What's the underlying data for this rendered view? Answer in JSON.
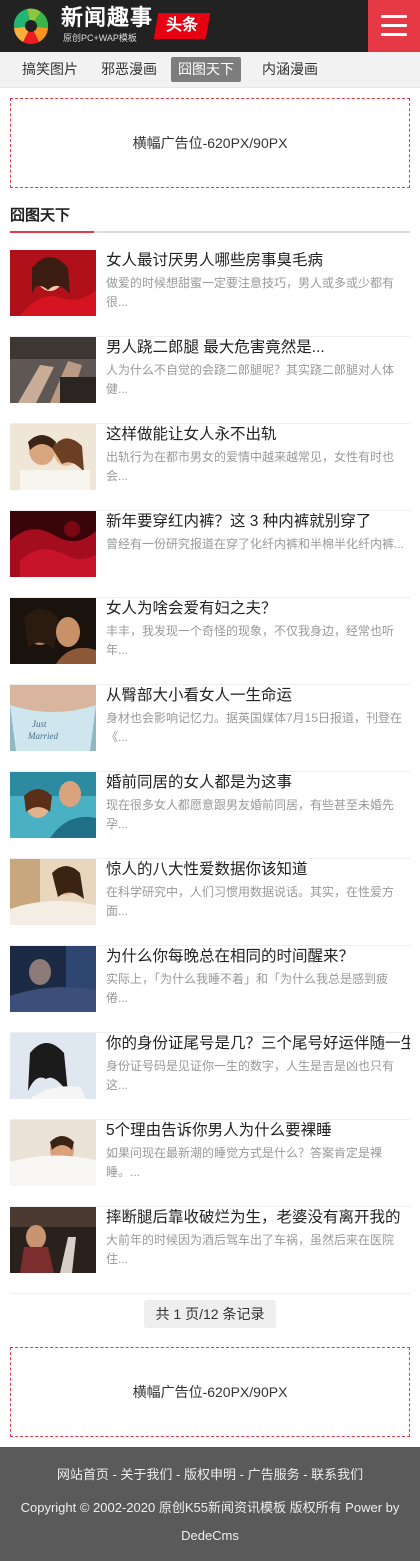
{
  "header": {
    "logo_title": "新闻趣事",
    "logo_subtitle": "原创PC+WAP模板",
    "logo_badge": "头条",
    "menu_icon": "hamburger-menu-icon",
    "accent_color": "#e63946"
  },
  "tabs": [
    {
      "label": "搞笑图片",
      "active": false
    },
    {
      "label": "邪恶漫画",
      "active": false
    },
    {
      "label": "囧图天下",
      "active": true
    },
    {
      "label": "内涵漫画",
      "active": false
    }
  ],
  "ad_top": "横幅广告位-620PX/90PX",
  "section_title": "囧图天下",
  "articles": [
    {
      "title": "女人最讨厌男人哪些房事臭毛病",
      "desc": "做爱的时候想甜蜜一定要注意技巧，男人或多或少都有很..."
    },
    {
      "title": "男人跷二郎腿 最大危害竟然是...",
      "desc": "人为什么不自觉的会跷二郎腿呢？其实跷二郎腿对人体健..."
    },
    {
      "title": "这样做能让女人永不出轨",
      "desc": "出轨行为在都市男女的爱情中越来越常见，女性有时也会..."
    },
    {
      "title": "新年要穿红内裤？这 3 种内裤就别穿了",
      "desc": "曾经有一份研究报道在穿了化纤内裤和半棉半化纤内裤..."
    },
    {
      "title": "女人为啥会爱有妇之夫？",
      "desc": "丰丰，我发现一个奇怪的现象，不仅我身边，经常也听年..."
    },
    {
      "title": "从臀部大小看女人一生命运",
      "desc": "身材也会影响记忆力。据英国媒体7月15日报道，刊登在《..."
    },
    {
      "title": "婚前同居的女人都是为这事",
      "desc": "现在很多女人都愿意跟男友婚前同居，有些甚至未婚先孕..."
    },
    {
      "title": "惊人的八大性爱数据你该知道",
      "desc": "在科学研究中，人们习惯用数据说话。其实，在性爱方面..."
    },
    {
      "title": "为什么你每晚总在相同的时间醒来？",
      "desc": "实际上，「为什么我睡不着」和「为什么我总是感到疲倦..."
    },
    {
      "title": "你的身份证尾号是几？三个尾号好运伴随一生",
      "desc": "身份证号码是见证你一生的数字，人生是吉是凶也只有这..."
    },
    {
      "title": "5个理由告诉你男人为什么要裸睡",
      "desc": "如果问现在最新潮的睡觉方式是什么？答案肯定是裸睡。..."
    },
    {
      "title": "摔断腿后靠收破烂为生，老婆没有离开我的",
      "desc": "大前年的时候因为酒后驾车出了车祸，虽然后来在医院住..."
    }
  ],
  "pager": "共 1 页/12 条记录",
  "ad_bottom": "横幅广告位-620PX/90PX",
  "footer": {
    "links": [
      "网站首页",
      "关于我们",
      "版权申明",
      "广告服务",
      "联系我们"
    ],
    "separator": " - ",
    "copyright": "Copyright © 2002-2020 原创K55新闻资讯模板 版权所有 Power by DedeCms"
  }
}
